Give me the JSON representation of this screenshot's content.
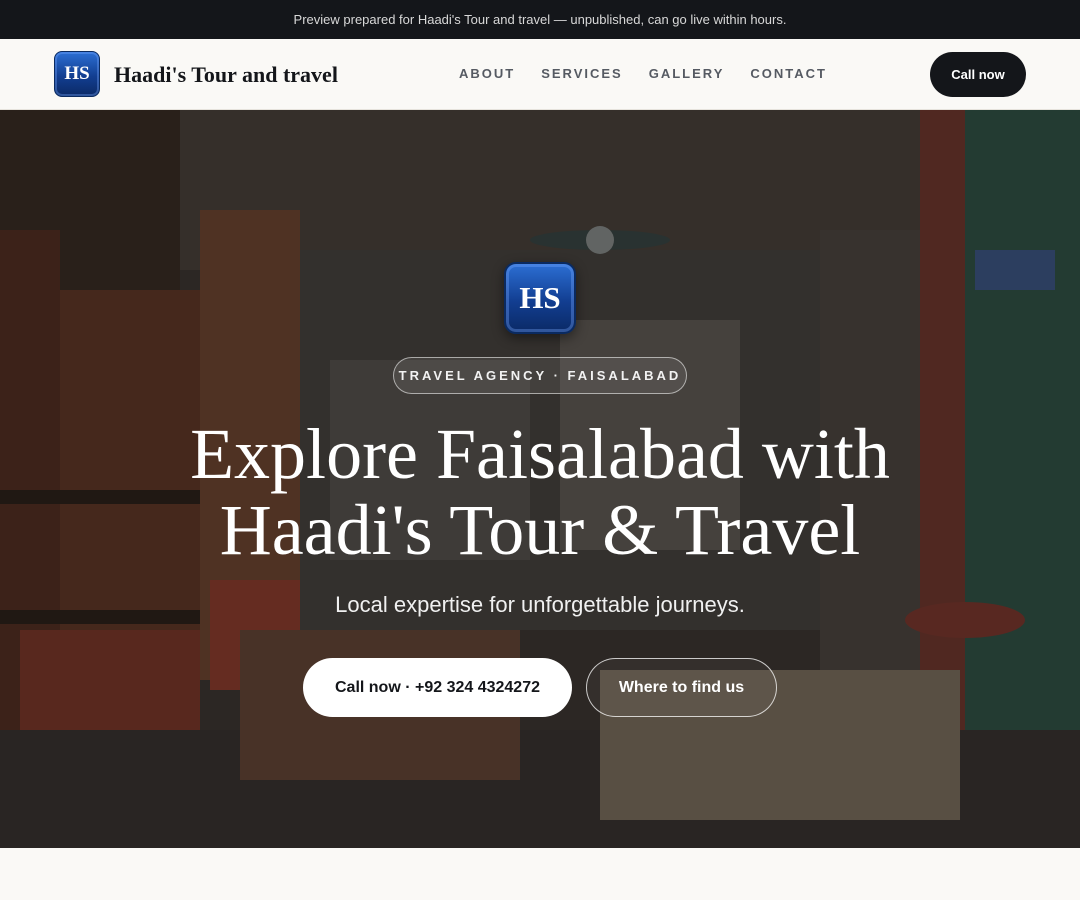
{
  "banner": {
    "text": "Preview prepared for Haadi's Tour and travel — unpublished, can go live within hours."
  },
  "header": {
    "logo_text": "HS",
    "brand_name": "Haadi's Tour and travel",
    "nav": [
      {
        "label": "ABOUT"
      },
      {
        "label": "SERVICES"
      },
      {
        "label": "GALLERY"
      },
      {
        "label": "CONTACT"
      }
    ],
    "cta_label": "Call now"
  },
  "hero": {
    "logo_text": "HS",
    "badge": "TRAVEL AGENCY · FAISALABAD",
    "title_line1": "Explore Faisalabad with",
    "title_line2": "Haadi's Tour & Travel",
    "subtitle": "Local expertise for unforgettable journeys.",
    "call_button": "Call now · +92 324 4324272",
    "find_button": "Where to find us",
    "background_image": "market-shop-interior-photo"
  },
  "colors": {
    "banner_bg": "#14161a",
    "page_bg": "#faf9f6",
    "logo_blue": "#123e91",
    "cta_dark": "#14161a"
  }
}
